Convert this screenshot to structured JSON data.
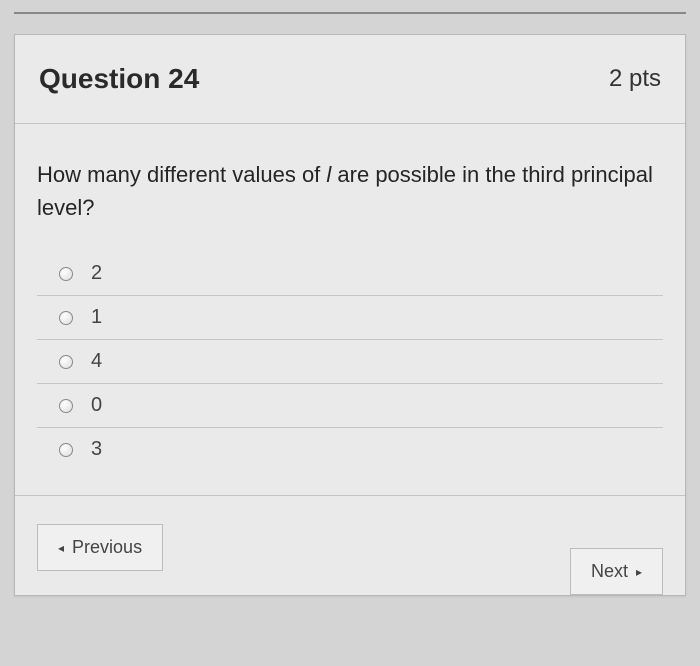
{
  "header": {
    "title": "Question 24",
    "points": "2 pts"
  },
  "question": {
    "prompt_before": "How many different values of ",
    "prompt_var": "l",
    "prompt_after": " are possible in the third principal level?"
  },
  "options": [
    {
      "label": "2"
    },
    {
      "label": "1"
    },
    {
      "label": "4"
    },
    {
      "label": "0"
    },
    {
      "label": "3"
    }
  ],
  "nav": {
    "prev_label": "Previous",
    "next_label": "Next",
    "prev_arrow": "◂",
    "next_arrow": "▸"
  }
}
